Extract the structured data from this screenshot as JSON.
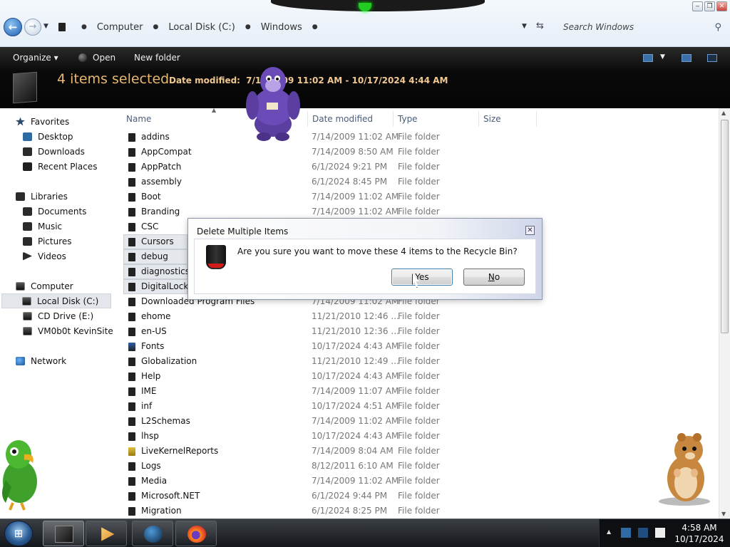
{
  "window": {
    "controls": {
      "minimize": "‒",
      "restore": "❐",
      "close": "✕"
    }
  },
  "address": {
    "back_glyph": "←",
    "forward_glyph": "→",
    "crumbs": [
      "Computer",
      "Local Disk (C:)",
      "Windows"
    ],
    "search_placeholder": "Search Windows"
  },
  "toolbar": {
    "organize": "Organize ▾",
    "open": "Open",
    "new_folder": "New folder"
  },
  "details": {
    "count": "4 items selected",
    "date_label": "Date modified:",
    "date_value": "7/14/2009 11:02 AM - 10/17/2024 4:44 AM"
  },
  "nav": {
    "favorites": "Favorites",
    "desktop": "Desktop",
    "downloads": "Downloads",
    "recent": "Recent Places",
    "libraries": "Libraries",
    "documents": "Documents",
    "music": "Music",
    "pictures": "Pictures",
    "videos": "Videos",
    "computer": "Computer",
    "local_disk": "Local Disk (C:)",
    "cd_drive": "CD Drive (E:)",
    "vm": "VM0b0t KevinSite",
    "network": "Network"
  },
  "columns": {
    "name": "Name",
    "date": "Date modified",
    "type": "Type",
    "size": "Size"
  },
  "files": [
    {
      "name": "addins",
      "date": "7/14/2009 11:02 AM",
      "type": "File folder"
    },
    {
      "name": "AppCompat",
      "date": "7/14/2009 8:50 AM",
      "type": "File folder"
    },
    {
      "name": "AppPatch",
      "date": "6/1/2024 9:21 PM",
      "type": "File folder"
    },
    {
      "name": "assembly",
      "date": "6/1/2024 8:45 PM",
      "type": "File folder"
    },
    {
      "name": "Boot",
      "date": "7/14/2009 11:02 AM",
      "type": "File folder"
    },
    {
      "name": "Branding",
      "date": "7/14/2009 11:02 AM",
      "type": "File folder"
    },
    {
      "name": "CSC",
      "date": "",
      "type": ""
    },
    {
      "name": "Cursors",
      "date": "",
      "type": ""
    },
    {
      "name": "debug",
      "date": "",
      "type": ""
    },
    {
      "name": "diagnostics",
      "date": "",
      "type": ""
    },
    {
      "name": "DigitalLocke",
      "date": "",
      "type": ""
    },
    {
      "name": "Downloaded Program Files",
      "date": "7/14/2009 11:02 AM",
      "type": "File folder"
    },
    {
      "name": "ehome",
      "date": "11/21/2010 12:46 ...",
      "type": "File folder"
    },
    {
      "name": "en-US",
      "date": "11/21/2010 12:36 ...",
      "type": "File folder"
    },
    {
      "name": "Fonts",
      "date": "10/17/2024 4:43 AM",
      "type": "File folder"
    },
    {
      "name": "Globalization",
      "date": "11/21/2010 12:49 ...",
      "type": "File folder"
    },
    {
      "name": "Help",
      "date": "10/17/2024 4:43 AM",
      "type": "File folder"
    },
    {
      "name": "IME",
      "date": "7/14/2009 11:07 AM",
      "type": "File folder"
    },
    {
      "name": "inf",
      "date": "10/17/2024 4:51 AM",
      "type": "File folder"
    },
    {
      "name": "L2Schemas",
      "date": "7/14/2009 11:02 AM",
      "type": "File folder"
    },
    {
      "name": "lhsp",
      "date": "10/17/2024 4:43 AM",
      "type": "File folder"
    },
    {
      "name": "LiveKernelReports",
      "date": "7/14/2009 8:04 AM",
      "type": "File folder"
    },
    {
      "name": "Logs",
      "date": "8/12/2011 6:10 AM",
      "type": "File folder"
    },
    {
      "name": "Media",
      "date": "7/14/2009 11:02 AM",
      "type": "File folder"
    },
    {
      "name": "Microsoft.NET",
      "date": "6/1/2024 9:44 PM",
      "type": "File folder"
    },
    {
      "name": "Migration",
      "date": "6/1/2024 8:25 PM",
      "type": "File folder"
    }
  ],
  "dialog": {
    "title": "Delete Multiple Items",
    "message": "Are you sure you want to move these 4 items to the Recycle Bin?",
    "yes": "Yes",
    "no": "No",
    "close_glyph": "✕"
  },
  "taskbar": {
    "start_glyph": "⊞",
    "time": "4:58 AM",
    "date": "10/17/2024"
  }
}
